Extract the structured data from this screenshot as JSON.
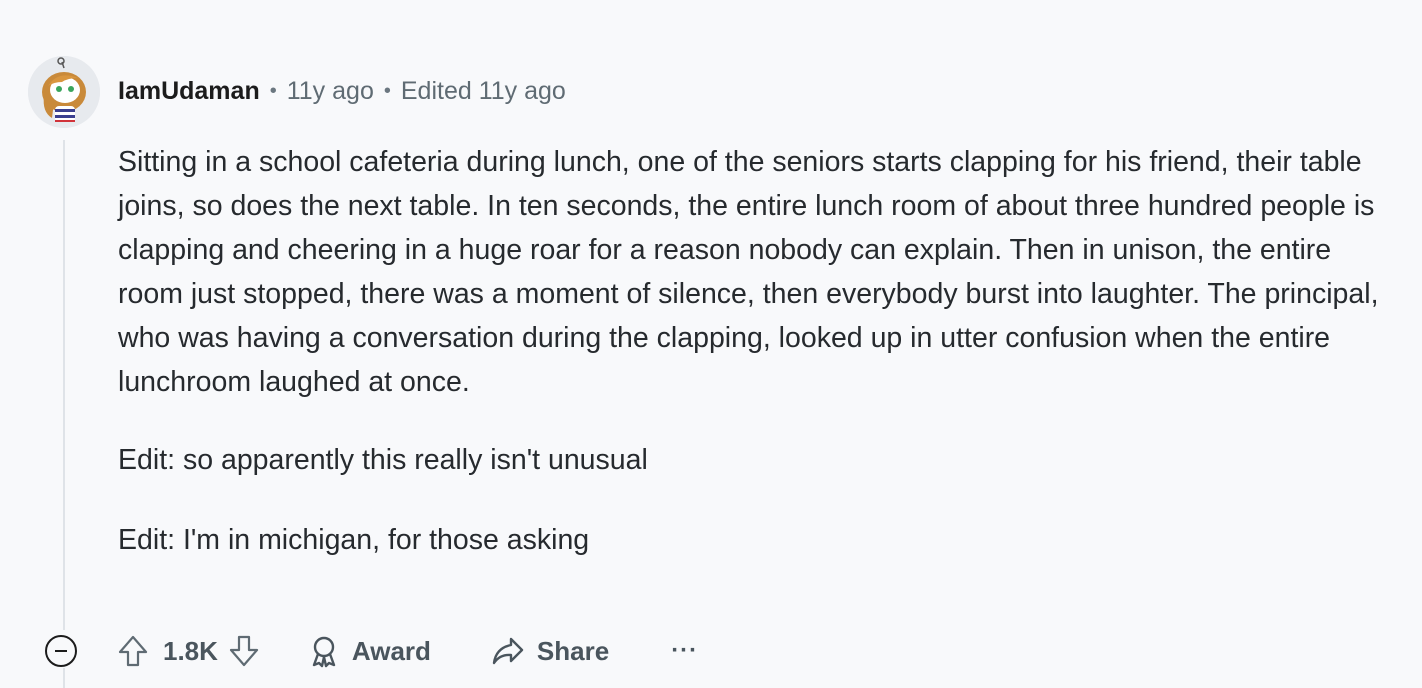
{
  "comment": {
    "author": "IamUdaman",
    "age": "11y ago",
    "edited": "Edited 11y ago",
    "body": "Sitting in a school cafeteria during lunch, one of the seniors starts clapping for his friend, their table joins, so does the next table. In ten seconds, the entire lunch room of about three hundred people is clapping and cheering in a huge roar for a reason nobody can explain. Then in unison, the entire room just stopped, there was a moment of silence, then everybody burst into laughter. The principal, who was having a conversation during the clapping, looked up in utter confusion when the entire lunchroom laughed at once.",
    "edit1": "Edit: so apparently this really isn't unusual",
    "edit2": "Edit: I'm in michigan, for those asking"
  },
  "actions": {
    "vote_count": "1.8K",
    "award_label": "Award",
    "share_label": "Share",
    "more_label": "···"
  },
  "icons": {
    "collapse": "collapse-icon",
    "upvote": "upvote-arrow-icon",
    "downvote": "downvote-arrow-icon",
    "award": "award-ribbon-icon",
    "share": "share-arrow-icon",
    "more": "more-dots-icon"
  }
}
